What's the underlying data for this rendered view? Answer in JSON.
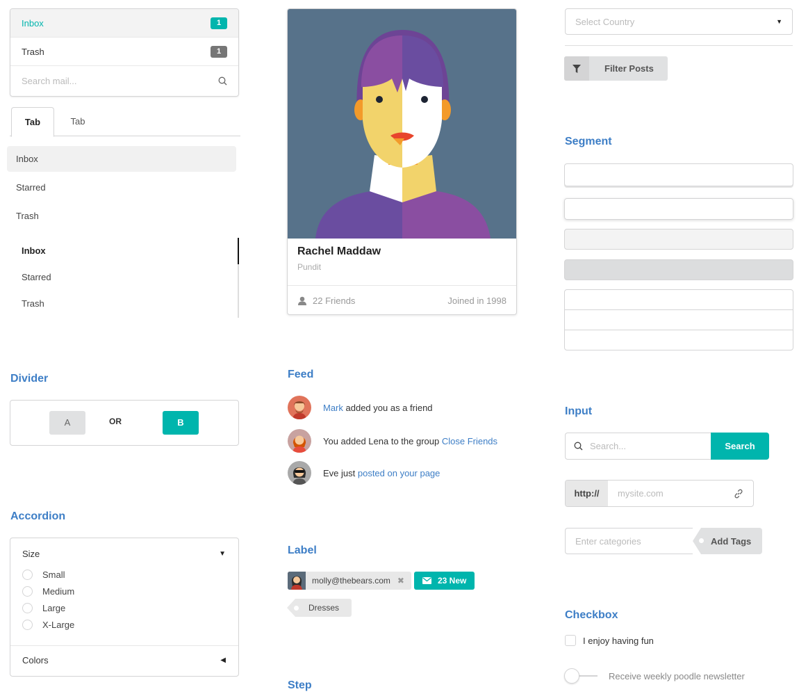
{
  "mail_menu": {
    "items": [
      {
        "label": "Inbox",
        "count": "1"
      },
      {
        "label": "Trash",
        "count": "1"
      }
    ],
    "search_placeholder": "Search mail..."
  },
  "tabs": [
    "Tab",
    "Tab"
  ],
  "vertical_menu": [
    "Inbox",
    "Starred",
    "Trash"
  ],
  "pointing_menu": [
    "Inbox",
    "Starred",
    "Trash"
  ],
  "divider": {
    "heading": "Divider",
    "button_a": "A",
    "or_label": "OR",
    "button_b": "B"
  },
  "accordion": {
    "heading": "Accordion",
    "section1_title": "Size",
    "options": [
      "Small",
      "Medium",
      "Large",
      "X-Large"
    ],
    "section2_title": "Colors"
  },
  "card": {
    "name": "Rachel Maddaw",
    "meta": "Pundit",
    "friends": "22 Friends",
    "joined": "Joined in 1998"
  },
  "feed": {
    "heading": "Feed",
    "events": [
      {
        "link": "Mark",
        "text": " added you as a friend"
      },
      {
        "text": "You added Lena to the group ",
        "link": "Close Friends"
      },
      {
        "text": "Eve just ",
        "link": "posted on your page"
      }
    ]
  },
  "labels": {
    "heading": "Label",
    "email": "molly@thebears.com",
    "new_count": "23 New",
    "tag": "Dresses"
  },
  "step": {
    "heading": "Step"
  },
  "dropdown": {
    "placeholder": "Select Country"
  },
  "filter_button": {
    "label": "Filter Posts"
  },
  "segment": {
    "heading": "Segment"
  },
  "input": {
    "heading": "Input",
    "search_placeholder": "Search...",
    "search_button": "Search",
    "url_prefix": "http://",
    "url_placeholder": "mysite.com",
    "tags_placeholder": "Enter categories",
    "tags_button": "Add Tags"
  },
  "checkbox": {
    "heading": "Checkbox",
    "label": "I enjoy having fun",
    "toggle_label": "Receive weekly poodle newsletter"
  },
  "colors": {
    "accent": "#00b5ad",
    "heading": "#3d7ec6",
    "link": "#3d7ec6"
  }
}
